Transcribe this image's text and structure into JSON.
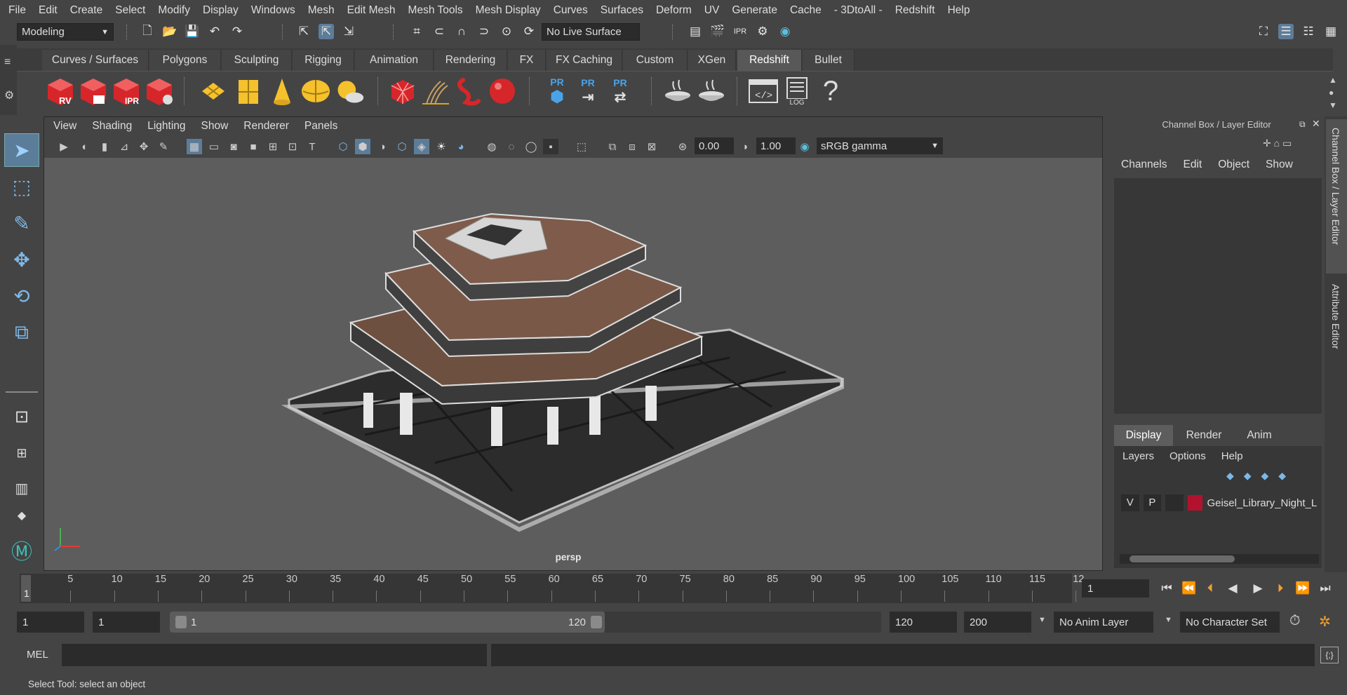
{
  "menu": [
    "File",
    "Edit",
    "Create",
    "Select",
    "Modify",
    "Display",
    "Windows",
    "Mesh",
    "Edit Mesh",
    "Mesh Tools",
    "Mesh Display",
    "Curves",
    "Surfaces",
    "Deform",
    "UV",
    "Generate",
    "Cache",
    "- 3DtoAll -",
    "Redshift",
    "Help"
  ],
  "status": {
    "mode": "Modeling",
    "live_surface": "No Live Surface"
  },
  "shelf_tabs": [
    "Curves / Surfaces",
    "Polygons",
    "Sculpting",
    "Rigging",
    "Animation",
    "Rendering",
    "FX",
    "FX Caching",
    "Custom",
    "XGen",
    "Redshift",
    "Bullet"
  ],
  "shelf_active": "Redshift",
  "shelf_labels": {
    "rv": "RV",
    "ipr": "IPR",
    "pr1": "PR",
    "pr2": "PR",
    "pr3": "PR",
    "log": "LOG",
    "help": "?"
  },
  "viewport": {
    "menu": [
      "View",
      "Shading",
      "Lighting",
      "Show",
      "Renderer",
      "Panels"
    ],
    "exposure": "0.00",
    "gamma": "1.00",
    "color_space": "sRGB gamma",
    "camera": "persp"
  },
  "channel_box": {
    "title": "Channel Box / Layer Editor",
    "menu": [
      "Channels",
      "Edit",
      "Object",
      "Show"
    ]
  },
  "layer_editor": {
    "tabs": [
      "Display",
      "Render",
      "Anim"
    ],
    "active_tab": "Display",
    "menu": [
      "Layers",
      "Options",
      "Help"
    ],
    "layer": {
      "v": "V",
      "p": "P",
      "name": "Geisel_Library_Night_L",
      "color": "#b3122e"
    }
  },
  "side_tabs": [
    "Channel Box / Layer Editor",
    "Attribute Editor"
  ],
  "timeline": {
    "ticks": [
      "5",
      "10",
      "15",
      "20",
      "25",
      "30",
      "35",
      "40",
      "45",
      "50",
      "55",
      "60",
      "65",
      "70",
      "75",
      "80",
      "85",
      "90",
      "95",
      "100",
      "105",
      "110",
      "115",
      "12"
    ],
    "current": "1",
    "current_field": "1"
  },
  "range": {
    "start": "1",
    "playback_start": "1",
    "slider_start": "1",
    "slider_end": "120",
    "playback_end": "120",
    "end": "200",
    "anim_layer": "No Anim Layer",
    "char_set": "No Character Set"
  },
  "command": {
    "label": "MEL"
  },
  "status_text": "Select Tool: select an object",
  "colors": {
    "accent": "#5c7d99",
    "redshift_red": "#d7262a",
    "shelf_yellow": "#f5c12c"
  }
}
